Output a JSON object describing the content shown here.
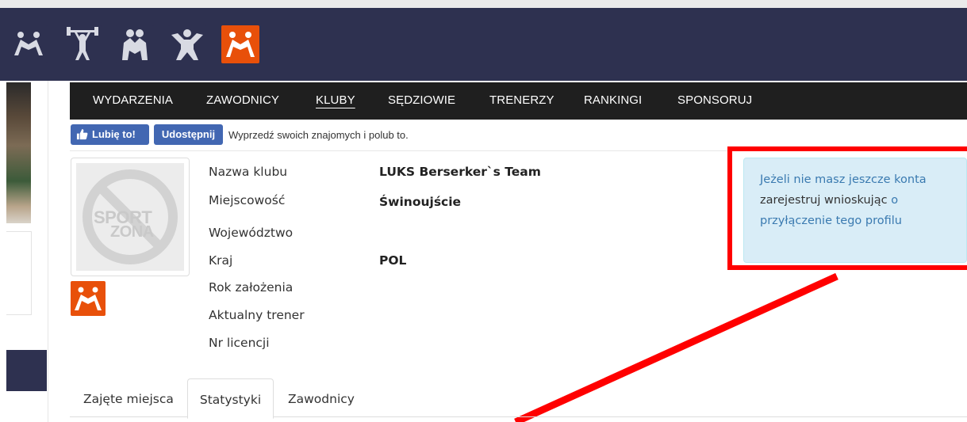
{
  "banner": {
    "icons": [
      {
        "name": "wrestling-icon",
        "color": "#2e3150"
      },
      {
        "name": "weightlifting-icon",
        "color": "#2e3150"
      },
      {
        "name": "sumo-icon",
        "color": "#2e3150"
      },
      {
        "name": "judo-icon",
        "color": "#2e3150"
      },
      {
        "name": "wrestling-active-icon",
        "color": "#e8500a"
      }
    ]
  },
  "nav": {
    "items": [
      {
        "label": "WYDARZENIA"
      },
      {
        "label": "ZAWODNICY"
      },
      {
        "label": "KLUBY",
        "active": true
      },
      {
        "label": "SĘDZIOWIE"
      },
      {
        "label": "TRENERZY"
      },
      {
        "label": "RANKINGI"
      },
      {
        "label": "SPONSORUJ"
      }
    ]
  },
  "facebook": {
    "like_label": "Lubię to!",
    "share_label": "Udostępnij",
    "prompt": "Wyprzedź swoich znajomych i polub to."
  },
  "logo": {
    "word1": "SPORT",
    "word2": "ZONA"
  },
  "club": {
    "fields": [
      {
        "label": "Nazwa klubu",
        "value": "LUKS Berserker`s Team"
      },
      {
        "label": "Miejscowość",
        "value": "Świnoujście"
      },
      {
        "label": "Województwo",
        "value": ""
      },
      {
        "label": "Kraj",
        "value": "POL"
      },
      {
        "label": "Rok założenia",
        "value": ""
      },
      {
        "label": "Aktualny trener",
        "value": ""
      },
      {
        "label": "Nr licencji",
        "value": ""
      }
    ]
  },
  "alert": {
    "link1": "Jeżeli nie masz jeszcze konta",
    "text1": " zarejestruj wnioskując ",
    "link2": "o przyłączenie tego profilu"
  },
  "tabs": [
    {
      "label": "Zajęte miejsca"
    },
    {
      "label": "Statystyki",
      "active": true
    },
    {
      "label": "Zawodnicy"
    }
  ],
  "colors": {
    "banner": "#2e3150",
    "nav": "#1f1f1f",
    "accent_orange": "#e8500a",
    "facebook": "#4267b2",
    "alert_bg": "#d9edf7",
    "annotation_red": "#ff0000"
  }
}
